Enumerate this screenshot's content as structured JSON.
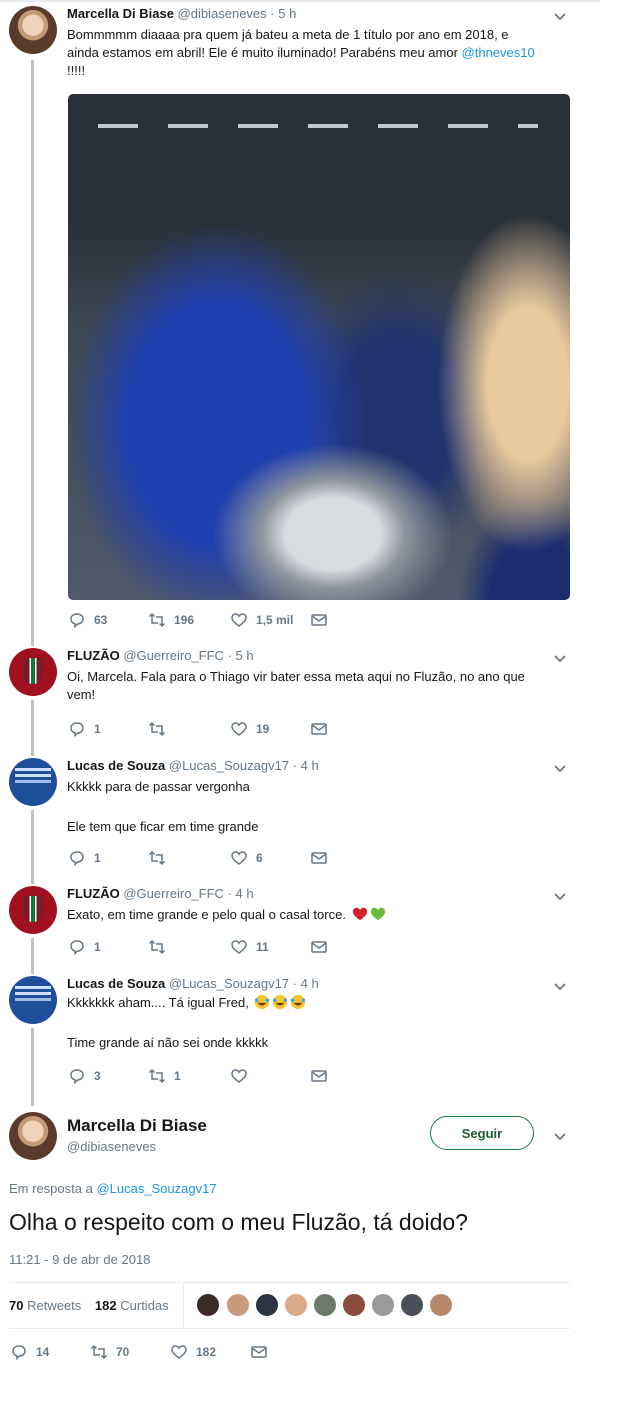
{
  "colors": {
    "accent_link": "#1b95e0",
    "thread_line": "#b9c8b4",
    "muted": "#657786",
    "follow_border": "#1a7a3a"
  },
  "tweets": [
    {
      "name": "Marcella Di Biase",
      "handle": "@dibiaseneves",
      "time": "· 5 h",
      "text_lines": [
        "Bommmmm diaaaa pra quem já bateu a meta de 1 título por ano em 2018, e",
        "ainda estamos em abril! Ele é muito iluminado! Parabéns meu amor "
      ],
      "mention": "@thneves10",
      "text_tail": "!!!!!",
      "replies": "63",
      "retweets": "196",
      "likes": "1,5 mil"
    },
    {
      "name": "FLUZÃO",
      "handle": "@Guerreiro_FFC",
      "time": "· 5 h",
      "text_lines": [
        "Oi, Marcela. Fala para o Thiago vir bater essa meta aqui no Fluzão, no ano que",
        "vem!"
      ],
      "replies": "1",
      "retweets": "",
      "likes": "19"
    },
    {
      "name": "Lucas de Souza",
      "handle": "@Lucas_Souzagv17",
      "time": "· 4 h",
      "text_lines": [
        "Kkkkk para de passar vergonha",
        "Ele tem que ficar em time grande"
      ],
      "replies": "1",
      "retweets": "",
      "likes": "6"
    },
    {
      "name": "FLUZÃO",
      "handle": "@Guerreiro_FFC",
      "time": "· 4 h",
      "text_lines": [
        "Exato, em time grande e pelo qual o casal torce."
      ],
      "replies": "1",
      "retweets": "",
      "likes": "11"
    },
    {
      "name": "Lucas de Souza",
      "handle": "@Lucas_Souzagv17",
      "time": "· 4 h",
      "text_lines": [
        "Kkkkkkk aham.... Tá igual Fred, ",
        "Time grande aí não sei onde kkkkk"
      ],
      "replies": "3",
      "retweets": "1",
      "likes": ""
    }
  ],
  "main_tweet": {
    "name": "Marcella Di Biase",
    "handle": "@dibiaseneves",
    "follow_label": "Seguir",
    "replying_prefix": "Em resposta a ",
    "replying_to": "@Lucas_Souzagv17",
    "text": "Olha o respeito com o meu Fluzão, tá doido?",
    "timestamp": "11:21 - 9 de abr de 2018",
    "retweets_count": "70",
    "retweets_label": "Retweets",
    "likes_count": "182",
    "likes_label": "Curtidas",
    "replies": "14",
    "retweets": "70",
    "likes": "182"
  },
  "icons": [
    "reply-icon",
    "retweet-icon",
    "like-icon",
    "message-icon",
    "chevron-down-icon",
    "heart-red-emoji",
    "heart-green-emoji",
    "laughing-emoji"
  ]
}
